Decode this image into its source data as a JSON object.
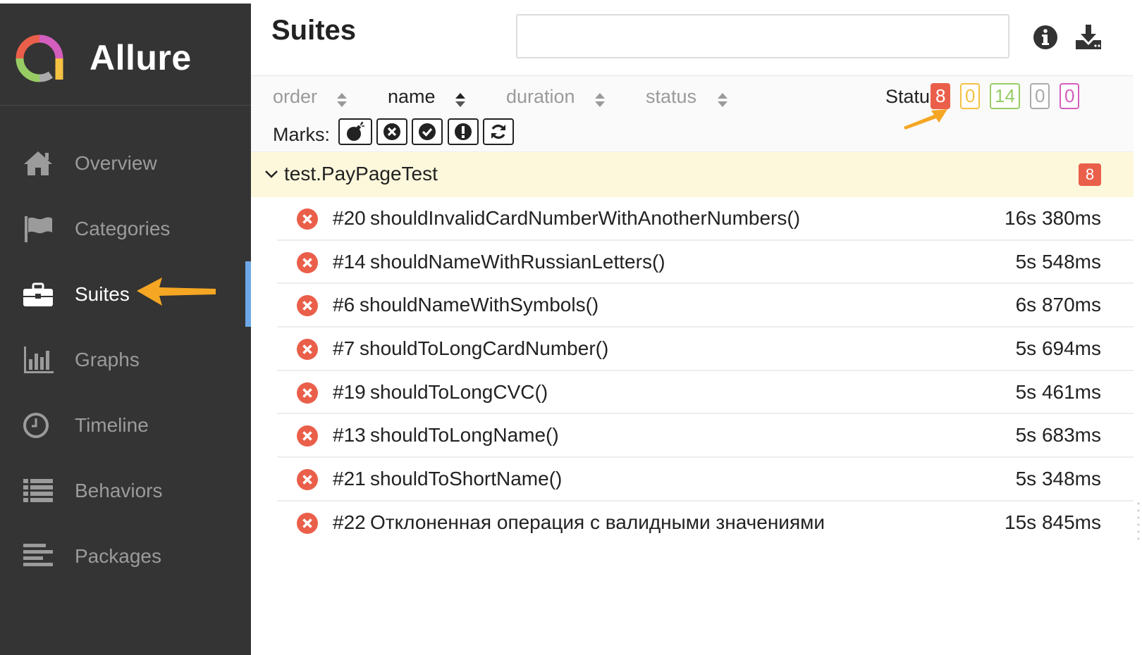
{
  "app": {
    "name": "Allure"
  },
  "sidebar": {
    "items": [
      {
        "label": "Overview",
        "icon": "home-icon"
      },
      {
        "label": "Categories",
        "icon": "flag-icon"
      },
      {
        "label": "Suites",
        "icon": "briefcase-icon",
        "active": true
      },
      {
        "label": "Graphs",
        "icon": "bar-chart-icon"
      },
      {
        "label": "Timeline",
        "icon": "clock-icon"
      },
      {
        "label": "Behaviors",
        "icon": "list-icon"
      },
      {
        "label": "Packages",
        "icon": "align-left-icon"
      }
    ]
  },
  "header": {
    "title": "Suites",
    "search": {
      "value": "",
      "placeholder": ""
    },
    "buttons": [
      "info-icon",
      "download-icon"
    ]
  },
  "toolbar": {
    "sort_columns": [
      "order",
      "name",
      "duration",
      "status"
    ],
    "active_sort": "name",
    "status_label": "Status:",
    "status_counts": [
      {
        "status": "failed",
        "count": "8",
        "color": "#ea5f4a"
      },
      {
        "status": "broken",
        "count": "0",
        "color": "#f5c143"
      },
      {
        "status": "passed",
        "count": "14",
        "color": "#97cc64"
      },
      {
        "status": "skipped",
        "count": "0",
        "color": "#aaaaaa"
      },
      {
        "status": "unknown",
        "count": "0",
        "color": "#d35ebe"
      }
    ],
    "marks_label": "Marks:",
    "marks": [
      "bomb-icon",
      "times-circle-icon",
      "check-circle-icon",
      "exclamation-circle-icon",
      "refresh-icon"
    ]
  },
  "suite": {
    "name": "test.PayPageTest",
    "count": "8",
    "tests": [
      {
        "order": "#20",
        "name": "shouldInvalidCardNumberWithAnotherNumbers()",
        "duration": "16s 380ms",
        "status": "failed"
      },
      {
        "order": "#14",
        "name": "shouldNameWithRussianLetters()",
        "duration": "5s 548ms",
        "status": "failed"
      },
      {
        "order": "#6",
        "name": "shouldNameWithSymbols()",
        "duration": "6s 870ms",
        "status": "failed"
      },
      {
        "order": "#7",
        "name": "shouldToLongCardNumber()",
        "duration": "5s 694ms",
        "status": "failed"
      },
      {
        "order": "#19",
        "name": "shouldToLongCVC()",
        "duration": "5s 461ms",
        "status": "failed"
      },
      {
        "order": "#13",
        "name": "shouldToLongName()",
        "duration": "5s 683ms",
        "status": "failed"
      },
      {
        "order": "#21",
        "name": "shouldToShortName()",
        "duration": "5s 348ms",
        "status": "failed"
      },
      {
        "order": "#22",
        "name": "Отклоненная операция с валидными значениями",
        "duration": "15s 845ms",
        "status": "failed"
      }
    ]
  },
  "colors": {
    "sidebar_bg": "#343434",
    "accent": "#6ea8e8",
    "failed": "#ea5f4a",
    "annotation_arrow": "#f5a623",
    "group_bg": "#fdf8dc"
  }
}
